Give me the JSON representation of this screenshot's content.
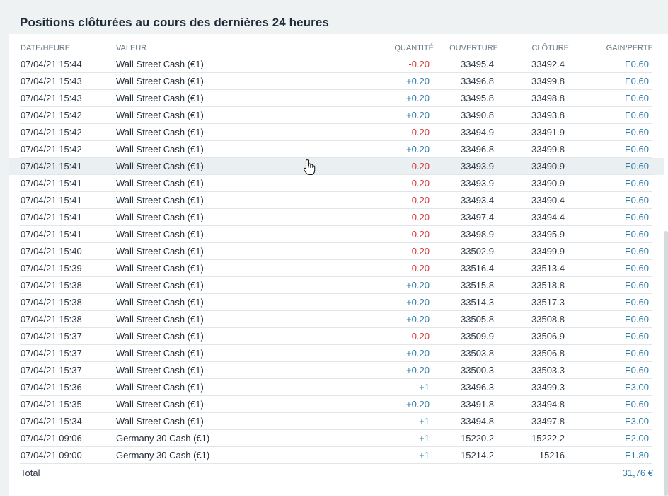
{
  "title": "Positions clôturées au cours des dernières 24 heures",
  "columns": {
    "date": "DATE/HEURE",
    "valeur": "VALEUR",
    "quantite": "QUANTITÉ",
    "ouverture": "OUVERTURE",
    "cloture": "CLÔTURE",
    "gain": "GAIN/PERTE"
  },
  "rows": [
    {
      "date": "07/04/21 15:44",
      "valeur": "Wall Street Cash (€1)",
      "qty": "-0.20",
      "open": "33495.4",
      "close": "33492.4",
      "gain": "E0.60"
    },
    {
      "date": "07/04/21 15:43",
      "valeur": "Wall Street Cash (€1)",
      "qty": "+0.20",
      "open": "33496.8",
      "close": "33499.8",
      "gain": "E0.60"
    },
    {
      "date": "07/04/21 15:43",
      "valeur": "Wall Street Cash (€1)",
      "qty": "+0.20",
      "open": "33495.8",
      "close": "33498.8",
      "gain": "E0.60"
    },
    {
      "date": "07/04/21 15:42",
      "valeur": "Wall Street Cash (€1)",
      "qty": "+0.20",
      "open": "33490.8",
      "close": "33493.8",
      "gain": "E0.60"
    },
    {
      "date": "07/04/21 15:42",
      "valeur": "Wall Street Cash (€1)",
      "qty": "-0.20",
      "open": "33494.9",
      "close": "33491.9",
      "gain": "E0.60"
    },
    {
      "date": "07/04/21 15:42",
      "valeur": "Wall Street Cash (€1)",
      "qty": "+0.20",
      "open": "33496.8",
      "close": "33499.8",
      "gain": "E0.60"
    },
    {
      "date": "07/04/21 15:41",
      "valeur": "Wall Street Cash (€1)",
      "qty": "-0.20",
      "open": "33493.9",
      "close": "33490.9",
      "gain": "E0.60",
      "highlight": true
    },
    {
      "date": "07/04/21 15:41",
      "valeur": "Wall Street Cash (€1)",
      "qty": "-0.20",
      "open": "33493.9",
      "close": "33490.9",
      "gain": "E0.60"
    },
    {
      "date": "07/04/21 15:41",
      "valeur": "Wall Street Cash (€1)",
      "qty": "-0.20",
      "open": "33493.4",
      "close": "33490.4",
      "gain": "E0.60"
    },
    {
      "date": "07/04/21 15:41",
      "valeur": "Wall Street Cash (€1)",
      "qty": "-0.20",
      "open": "33497.4",
      "close": "33494.4",
      "gain": "E0.60"
    },
    {
      "date": "07/04/21 15:41",
      "valeur": "Wall Street Cash (€1)",
      "qty": "-0.20",
      "open": "33498.9",
      "close": "33495.9",
      "gain": "E0.60"
    },
    {
      "date": "07/04/21 15:40",
      "valeur": "Wall Street Cash (€1)",
      "qty": "-0.20",
      "open": "33502.9",
      "close": "33499.9",
      "gain": "E0.60"
    },
    {
      "date": "07/04/21 15:39",
      "valeur": "Wall Street Cash (€1)",
      "qty": "-0.20",
      "open": "33516.4",
      "close": "33513.4",
      "gain": "E0.60"
    },
    {
      "date": "07/04/21 15:38",
      "valeur": "Wall Street Cash (€1)",
      "qty": "+0.20",
      "open": "33515.8",
      "close": "33518.8",
      "gain": "E0.60"
    },
    {
      "date": "07/04/21 15:38",
      "valeur": "Wall Street Cash (€1)",
      "qty": "+0.20",
      "open": "33514.3",
      "close": "33517.3",
      "gain": "E0.60"
    },
    {
      "date": "07/04/21 15:38",
      "valeur": "Wall Street Cash (€1)",
      "qty": "+0.20",
      "open": "33505.8",
      "close": "33508.8",
      "gain": "E0.60"
    },
    {
      "date": "07/04/21 15:37",
      "valeur": "Wall Street Cash (€1)",
      "qty": "-0.20",
      "open": "33509.9",
      "close": "33506.9",
      "gain": "E0.60"
    },
    {
      "date": "07/04/21 15:37",
      "valeur": "Wall Street Cash (€1)",
      "qty": "+0.20",
      "open": "33503.8",
      "close": "33506.8",
      "gain": "E0.60"
    },
    {
      "date": "07/04/21 15:37",
      "valeur": "Wall Street Cash (€1)",
      "qty": "+0.20",
      "open": "33500.3",
      "close": "33503.3",
      "gain": "E0.60"
    },
    {
      "date": "07/04/21 15:36",
      "valeur": "Wall Street Cash (€1)",
      "qty": "+1",
      "open": "33496.3",
      "close": "33499.3",
      "gain": "E3.00"
    },
    {
      "date": "07/04/21 15:35",
      "valeur": "Wall Street Cash (€1)",
      "qty": "+0.20",
      "open": "33491.8",
      "close": "33494.8",
      "gain": "E0.60"
    },
    {
      "date": "07/04/21 15:34",
      "valeur": "Wall Street Cash (€1)",
      "qty": "+1",
      "open": "33494.8",
      "close": "33497.8",
      "gain": "E3.00"
    },
    {
      "date": "07/04/21 09:06",
      "valeur": "Germany 30 Cash (€1)",
      "qty": "+1",
      "open": "15220.2",
      "close": "15222.2",
      "gain": "E2.00"
    },
    {
      "date": "07/04/21 09:00",
      "valeur": "Germany 30 Cash (€1)",
      "qty": "+1",
      "open": "15214.2",
      "close": "15216",
      "gain": "E1.80"
    }
  ],
  "total": {
    "label": "Total",
    "value": "31,76 €"
  },
  "colors": {
    "negative": "#d3343a",
    "positive": "#2e7ca8",
    "highlight_row": "#eaf0f2"
  },
  "icons": {
    "cursor": "hand-pointer-icon"
  }
}
